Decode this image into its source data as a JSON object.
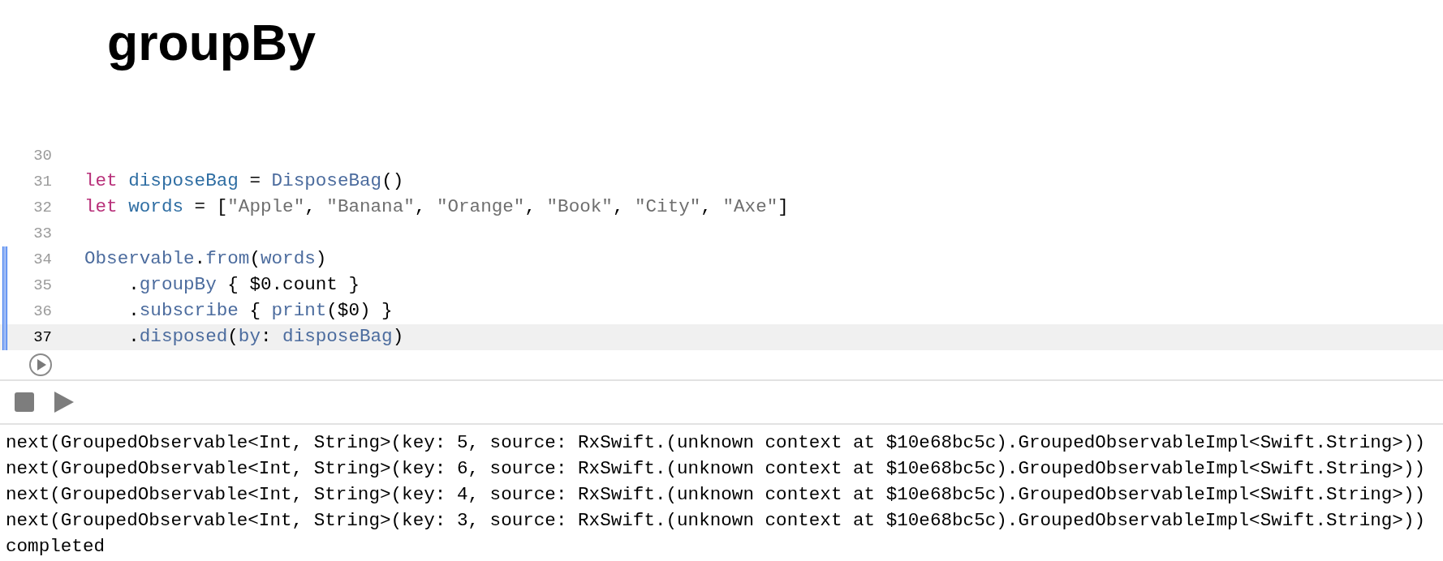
{
  "title": "groupBy",
  "code_lines": [
    {
      "number": "30",
      "current": false,
      "changed": false
    },
    {
      "number": "31",
      "current": false,
      "changed": false,
      "tokens": [
        {
          "text": "let",
          "kind": "keyword"
        },
        {
          "text": " disposeBag",
          "kind": "decl"
        },
        {
          "text": " = ",
          "kind": "plain"
        },
        {
          "text": "DisposeBag",
          "kind": "ref"
        },
        {
          "text": "()",
          "kind": "plain"
        }
      ]
    },
    {
      "number": "32",
      "current": false,
      "changed": false,
      "tokens": [
        {
          "text": "let",
          "kind": "keyword"
        },
        {
          "text": " words",
          "kind": "decl"
        },
        {
          "text": " = [",
          "kind": "plain"
        },
        {
          "text": "\"Apple\"",
          "kind": "string"
        },
        {
          "text": ", ",
          "kind": "plain"
        },
        {
          "text": "\"Banana\"",
          "kind": "string"
        },
        {
          "text": ", ",
          "kind": "plain"
        },
        {
          "text": "\"Orange\"",
          "kind": "string"
        },
        {
          "text": ", ",
          "kind": "plain"
        },
        {
          "text": "\"Book\"",
          "kind": "string"
        },
        {
          "text": ", ",
          "kind": "plain"
        },
        {
          "text": "\"City\"",
          "kind": "string"
        },
        {
          "text": ", ",
          "kind": "plain"
        },
        {
          "text": "\"Axe\"",
          "kind": "string"
        },
        {
          "text": "]",
          "kind": "plain"
        }
      ]
    },
    {
      "number": "33",
      "current": false,
      "changed": false
    },
    {
      "number": "34",
      "current": false,
      "changed": true,
      "tokens": [
        {
          "text": "Observable",
          "kind": "ref"
        },
        {
          "text": ".",
          "kind": "plain"
        },
        {
          "text": "from",
          "kind": "ref"
        },
        {
          "text": "(",
          "kind": "plain"
        },
        {
          "text": "words",
          "kind": "ref"
        },
        {
          "text": ")",
          "kind": "plain"
        }
      ]
    },
    {
      "number": "35",
      "current": false,
      "changed": true,
      "tokens": [
        {
          "text": "    .",
          "kind": "plain"
        },
        {
          "text": "groupBy",
          "kind": "ref"
        },
        {
          "text": " { $0.count }",
          "kind": "plain"
        }
      ]
    },
    {
      "number": "36",
      "current": false,
      "changed": true,
      "tokens": [
        {
          "text": "    .",
          "kind": "plain"
        },
        {
          "text": "subscribe",
          "kind": "ref"
        },
        {
          "text": " { ",
          "kind": "plain"
        },
        {
          "text": "print",
          "kind": "ref"
        },
        {
          "text": "($0) }",
          "kind": "plain"
        }
      ]
    },
    {
      "number": "37",
      "current": true,
      "changed": true,
      "tokens": [
        {
          "text": "    .",
          "kind": "plain"
        },
        {
          "text": "disposed",
          "kind": "ref"
        },
        {
          "text": "(",
          "kind": "plain"
        },
        {
          "text": "by",
          "kind": "ref"
        },
        {
          "text": ": ",
          "kind": "plain"
        },
        {
          "text": "disposeBag",
          "kind": "ref"
        },
        {
          "text": ")",
          "kind": "plain"
        }
      ]
    }
  ],
  "console": [
    "next(GroupedObservable<Int, String>(key: 5, source: RxSwift.(unknown context at $10e68bc5c).GroupedObservableImpl<Swift.String>))",
    "next(GroupedObservable<Int, String>(key: 6, source: RxSwift.(unknown context at $10e68bc5c).GroupedObservableImpl<Swift.String>))",
    "next(GroupedObservable<Int, String>(key: 4, source: RxSwift.(unknown context at $10e68bc5c).GroupedObservableImpl<Swift.String>))",
    "next(GroupedObservable<Int, String>(key: 3, source: RxSwift.(unknown context at $10e68bc5c).GroupedObservableImpl<Swift.String>))",
    "completed"
  ]
}
